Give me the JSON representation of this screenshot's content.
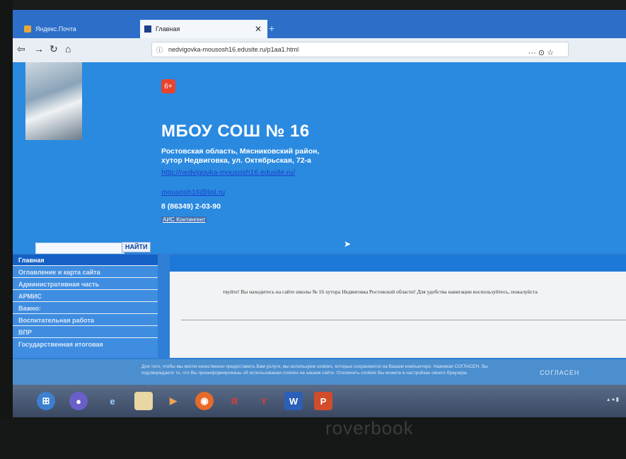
{
  "browser": {
    "tabs": [
      {
        "label": "Яндекс.Почта"
      },
      {
        "label": "Главная"
      }
    ],
    "new_tab": "+",
    "url": "nedvigovka-mousosh16.edusite.ru/p1aa1.html",
    "menu_dots": "···"
  },
  "header": {
    "age_rating": "6+",
    "title": "МБОУ СОШ № 16",
    "address_line1": "Ростовская область, Мясниковский район,",
    "address_line2": "хутор Недвиговка, ул. Октябрьская, 72-а",
    "site_link": "http://nedvigovka-mousosh16.edusite.ru/",
    "email": "mousosh16@list.ru",
    "phone": "8 (86349) 2-03-90",
    "ais_link": "АИС Контингент",
    "search_placeholder": "",
    "search_button": "НАЙТИ"
  },
  "sidebar": {
    "items": [
      {
        "label": "Главная"
      },
      {
        "label": "Оглавление и карта сайта"
      },
      {
        "label": "Административная часть"
      },
      {
        "label": "АРМИС"
      },
      {
        "label": "Важно:"
      },
      {
        "label": "Воспитательная работа"
      },
      {
        "label": "ВПР"
      },
      {
        "label": "Государственная итоговая"
      }
    ]
  },
  "content": {
    "welcome_text": "твуйте! Вы находитесь на сайте школы № 16 хутора Недвиговка Ростовской области! Для удобства навигации воспользуйтесь, пожалуйста"
  },
  "cookie": {
    "text": "Для того, чтобы мы могли качественно предоставить Вам услуги, мы используем cookies, которые сохраняются на Вашем компьютере. Нажимая СОГЛАСЕН, Вы подтверждаете то, что Вы проинформированы об использовании cookies на нашем сайте. Отключить cookies Вы можете в настройках своего браузера.",
    "button": "СОГЛАСЕН"
  },
  "taskbar": {
    "word_label": "W",
    "ppt_label": "P",
    "yandex_label": "Я",
    "y_label": "Y"
  },
  "laptop": {
    "brand": "roverbook"
  }
}
